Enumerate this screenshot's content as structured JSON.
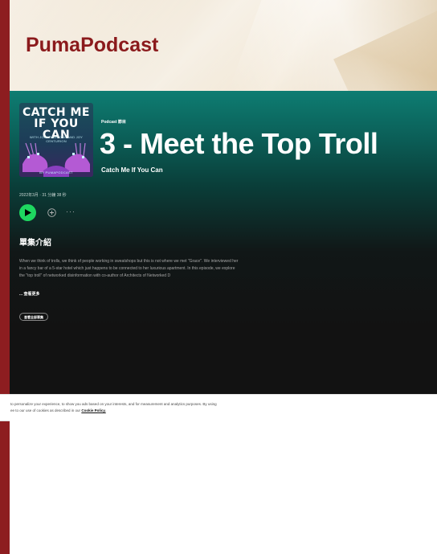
{
  "brand": {
    "title": "PumaPodcast"
  },
  "episode": {
    "cover": {
      "title_line1": "CATCH ME",
      "title_line2": "IF YOU CAN",
      "subtitle": "WITH JONATHAN ONG AND JOY CENTURION",
      "credit": "BY PUMAPODCAST"
    },
    "type_label": "Podcast 節目",
    "title": "3 - Meet the Top Troll",
    "show_name": "Catch Me If You Can",
    "meta": "2022年3月 · 31 分鐘 38 秒"
  },
  "actions": {
    "more_label": "···"
  },
  "description": {
    "heading": "單集介紹",
    "text": "When we think of trolls, we think of people working in sweatshops but this is not where we met \"Grace\". We interviewed her in a fancy bar of a 5-star hotel which just happens to be connected to her luxurious apartment. In this episode, we explore the \"top troll\" of networked disinformation with co-author of Architects of Networked D",
    "see_more": "... 查看更多",
    "all_episodes_button": "查看全部單集"
  },
  "cookie_banner": {
    "line1": "to personalize your experience, to show you ads based on your interests, and for measurement and analytics purposes. By using",
    "line2_prefix": "ee to our use of cookies as described in our",
    "link": "Cookie Policy."
  },
  "colors": {
    "brand": "#8b1a1c",
    "accent_green": "#1ed760",
    "header_teal": "#0e7d72",
    "app_bg": "#121212"
  }
}
